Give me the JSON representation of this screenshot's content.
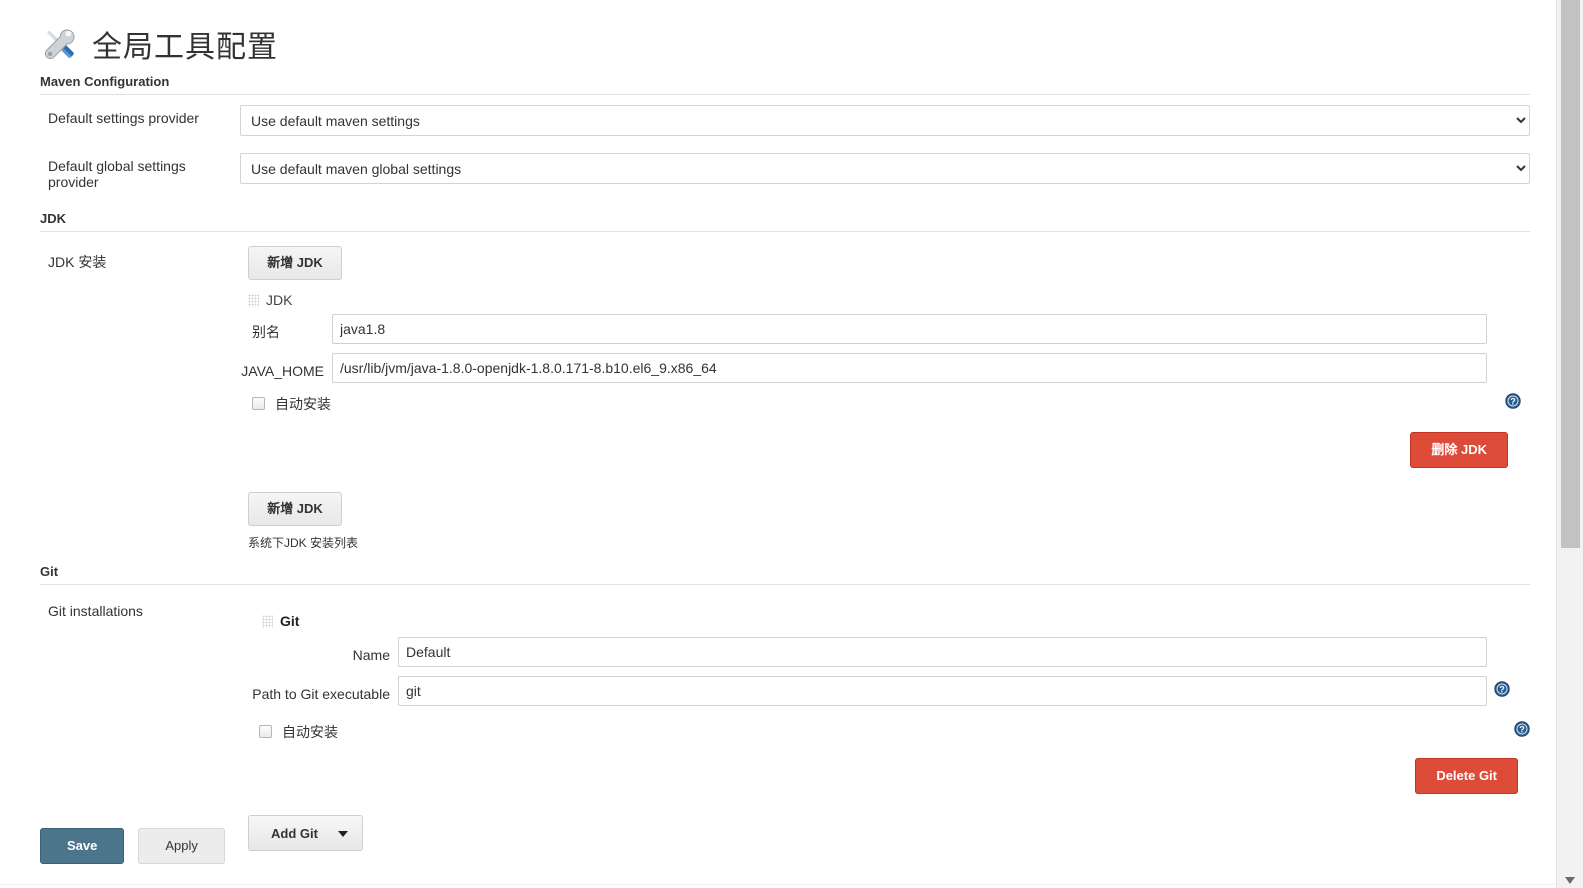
{
  "header": {
    "title": "全局工具配置",
    "icon": "tools-icon"
  },
  "maven": {
    "section_title": "Maven Configuration",
    "default_settings_provider": {
      "label": "Default settings provider",
      "value": "Use default maven settings"
    },
    "default_global_settings_provider": {
      "label": "Default global settings provider",
      "value": "Use default maven global settings"
    }
  },
  "jdk": {
    "section_title": "JDK",
    "row_label": "JDK 安装",
    "add_button_top": "新增 JDK",
    "entry_title": "JDK",
    "alias_label": "别名",
    "alias_value": "java1.8",
    "java_home_label": "JAVA_HOME",
    "java_home_value": "/usr/lib/jvm/java-1.8.0-openjdk-1.8.0.171-8.b10.el6_9.x86_64",
    "auto_install_label": "自动安装",
    "delete_button": "删除 JDK",
    "add_button_bottom": "新增 JDK",
    "hint": "系统下JDK 安装列表"
  },
  "git": {
    "section_title": "Git",
    "row_label": "Git installations",
    "entry_title": "Git",
    "name_label": "Name",
    "name_value": "Default",
    "path_label": "Path to Git executable",
    "path_value": "git",
    "auto_install_label": "自动安装",
    "delete_button": "Delete Git",
    "add_button": "Add Git"
  },
  "footer": {
    "save_label": "Save",
    "apply_label": "Apply"
  },
  "colors": {
    "primary": "#4b758b",
    "danger": "#dd4b39",
    "help_icon": "#2a5d8f",
    "text": "#333333",
    "border": "#e0e0e0"
  }
}
